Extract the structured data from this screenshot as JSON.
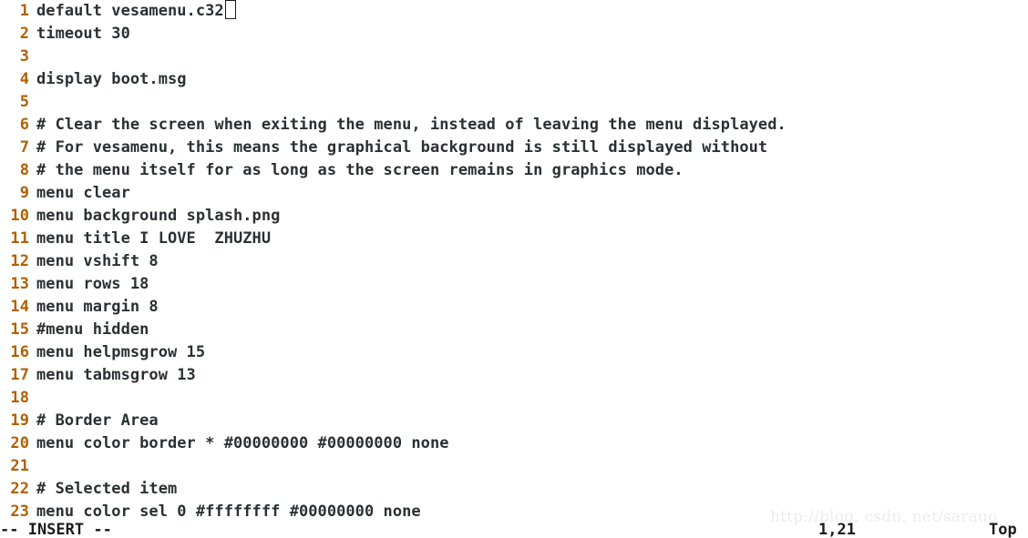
{
  "editor": {
    "mode_indicator": "-- INSERT --",
    "cursor_position": "1,21",
    "scroll_indicator": "Top",
    "colors": {
      "background": "#ffffff",
      "text": "#2b3032",
      "line_number": "#b06000",
      "cursor_border": "#1a1a1a",
      "watermark": "#eceded"
    },
    "lines": [
      {
        "number": "1",
        "text": "default vesamenu.c32",
        "cursor_after": true
      },
      {
        "number": "2",
        "text": "timeout 30",
        "cursor_after": false
      },
      {
        "number": "3",
        "text": "",
        "cursor_after": false
      },
      {
        "number": "4",
        "text": "display boot.msg",
        "cursor_after": false
      },
      {
        "number": "5",
        "text": "",
        "cursor_after": false
      },
      {
        "number": "6",
        "text": "# Clear the screen when exiting the menu, instead of leaving the menu displayed.",
        "cursor_after": false
      },
      {
        "number": "7",
        "text": "# For vesamenu, this means the graphical background is still displayed without",
        "cursor_after": false
      },
      {
        "number": "8",
        "text": "# the menu itself for as long as the screen remains in graphics mode.",
        "cursor_after": false
      },
      {
        "number": "9",
        "text": "menu clear",
        "cursor_after": false
      },
      {
        "number": "10",
        "text": "menu background splash.png",
        "cursor_after": false
      },
      {
        "number": "11",
        "text": "menu title I LOVE  ZHUZHU",
        "cursor_after": false
      },
      {
        "number": "12",
        "text": "menu vshift 8",
        "cursor_after": false
      },
      {
        "number": "13",
        "text": "menu rows 18",
        "cursor_after": false
      },
      {
        "number": "14",
        "text": "menu margin 8",
        "cursor_after": false
      },
      {
        "number": "15",
        "text": "#menu hidden",
        "cursor_after": false
      },
      {
        "number": "16",
        "text": "menu helpmsgrow 15",
        "cursor_after": false
      },
      {
        "number": "17",
        "text": "menu tabmsgrow 13",
        "cursor_after": false
      },
      {
        "number": "18",
        "text": "",
        "cursor_after": false
      },
      {
        "number": "19",
        "text": "# Border Area",
        "cursor_after": false
      },
      {
        "number": "20",
        "text": "menu color border * #00000000 #00000000 none",
        "cursor_after": false
      },
      {
        "number": "21",
        "text": "",
        "cursor_after": false
      },
      {
        "number": "22",
        "text": "# Selected item",
        "cursor_after": false
      },
      {
        "number": "23",
        "text": "menu color sel 0 #ffffffff #00000000 none",
        "cursor_after": false
      }
    ]
  },
  "watermark": {
    "text": "http://blog. csdn. net/sarauo"
  }
}
